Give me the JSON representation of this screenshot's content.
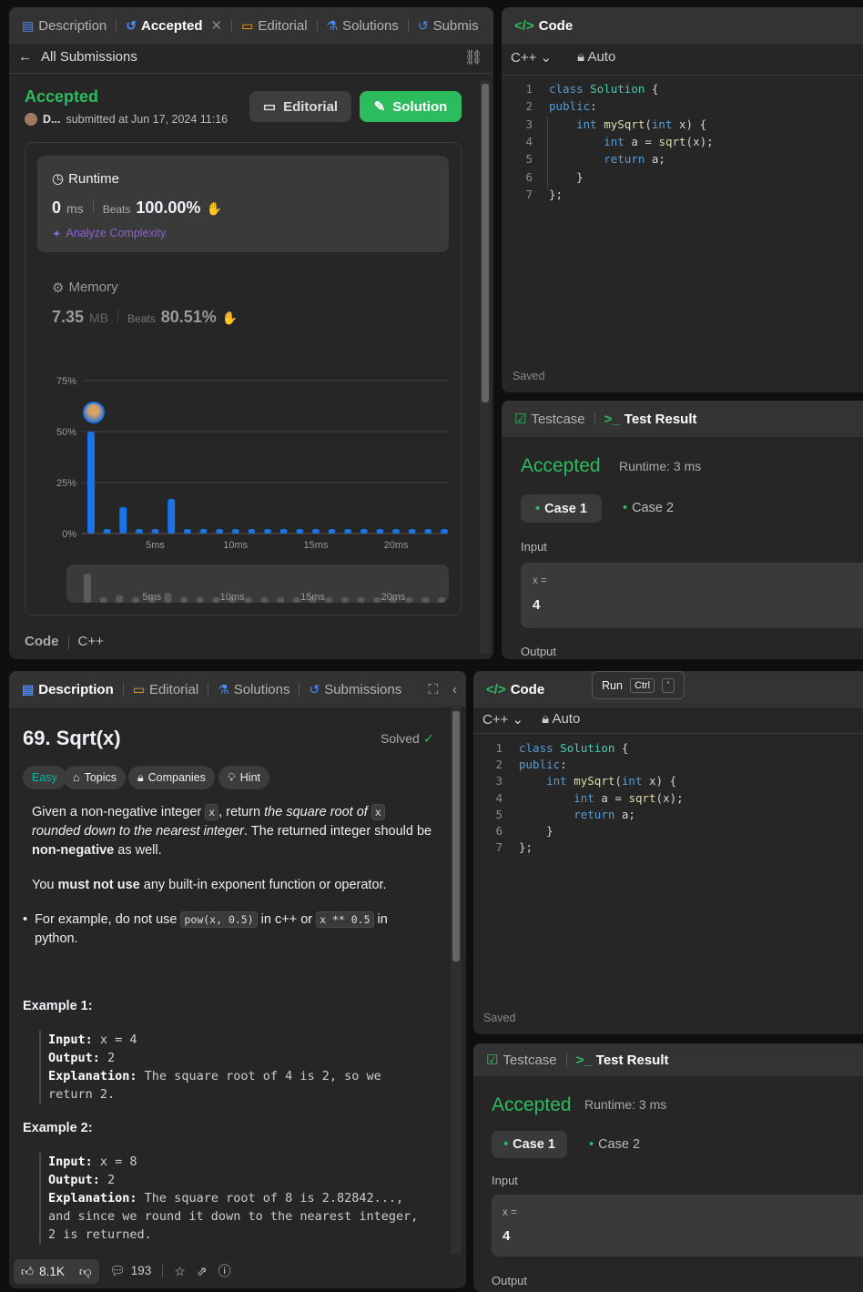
{
  "top_left": {
    "tabs": [
      "Description",
      "Accepted",
      "Editorial",
      "Solutions",
      "Submis"
    ],
    "back_label": "All Submissions",
    "status": "Accepted",
    "user": "D...",
    "submitted": "submitted at Jun 17, 2024 11:16",
    "editorial_btn": "Editorial",
    "solution_btn": "Solution",
    "runtime": {
      "label": "Runtime",
      "value": "0",
      "unit": "ms",
      "beats_label": "Beats",
      "beats": "100.00%",
      "analyze": "Analyze Complexity"
    },
    "memory": {
      "label": "Memory",
      "value": "7.35",
      "unit": "MB",
      "beats_label": "Beats",
      "beats": "80.51%"
    },
    "footer_code": "Code",
    "footer_lang": "C++"
  },
  "chart_data": {
    "type": "bar",
    "y_ticks": [
      "75%",
      "50%",
      "25%",
      "0%"
    ],
    "x_ticks": [
      "5ms",
      "10ms",
      "15ms",
      "20ms"
    ],
    "ylim": [
      0,
      75
    ],
    "values": [
      50,
      2,
      13,
      2,
      2,
      17,
      2,
      2,
      2,
      2,
      2,
      2,
      2,
      2,
      2,
      2,
      2,
      2,
      2,
      2,
      2,
      2,
      2
    ],
    "mini_x_ticks": [
      "5ms",
      "10ms",
      "15ms",
      "20ms"
    ]
  },
  "code": {
    "title": "Code",
    "lang": "C++",
    "mode": "Auto",
    "lines": [
      "class Solution {",
      "public:",
      "    int mySqrt(int x) {",
      "        int a = sqrt(x);",
      "        return a;",
      "    }",
      "};"
    ],
    "saved": "Saved"
  },
  "result": {
    "testcase_tab": "Testcase",
    "result_tab": "Test Result",
    "status": "Accepted",
    "runtime": "Runtime: 3 ms",
    "case1": "Case 1",
    "case2": "Case 2",
    "input_label": "Input",
    "var": "x =",
    "value": "4",
    "output_label": "Output"
  },
  "run_tooltip": {
    "label": "Run",
    "key1": "Ctrl",
    "key2": "'"
  },
  "problem": {
    "tabs": [
      "Description",
      "Editorial",
      "Solutions",
      "Submissions"
    ],
    "title": "69. Sqrt(x)",
    "solved": "Solved",
    "difficulty": "Easy",
    "chips": [
      "Topics",
      "Companies",
      "Hint"
    ],
    "p1": {
      "a": "Given a non-negative integer ",
      "code1": "x",
      "b": ", return ",
      "c": "the square root of ",
      "code2": "x",
      "d": " rounded down to the nearest integer",
      "e": ". The returned integer should be ",
      "f": "non-negative",
      "g": " as well."
    },
    "p2": {
      "a": "You ",
      "b": "must not use",
      "c": " any built-in exponent function or operator."
    },
    "bullet": {
      "a": "For example, do not use ",
      "code1": "pow(x, 0.5)",
      "b": " in c++ or ",
      "code2": "x ** 0.5",
      "c": " in python."
    },
    "ex1": {
      "title": "Example 1:",
      "input_k": "Input:",
      "input_v": " x = 4",
      "output_k": "Output:",
      "output_v": " 2",
      "expl_k": "Explanation:",
      "expl_v": " The square root of 4 is 2, so we",
      "expl_v2": "return 2."
    },
    "ex2": {
      "title": "Example 2:",
      "input_k": "Input:",
      "input_v": " x = 8",
      "output_k": "Output:",
      "output_v": " 2",
      "expl_k": "Explanation:",
      "expl_v": " The square root of 8 is 2.82842...,",
      "expl_v2": "and since we round it down to the nearest integer,",
      "expl_v3": "2 is returned."
    },
    "likes": "8.1K",
    "comments": "193"
  },
  "colors": {
    "accent_green": "#2cbb5d",
    "bar_blue": "#1a73e8",
    "panel": "#262626",
    "tabbar": "#333333"
  }
}
